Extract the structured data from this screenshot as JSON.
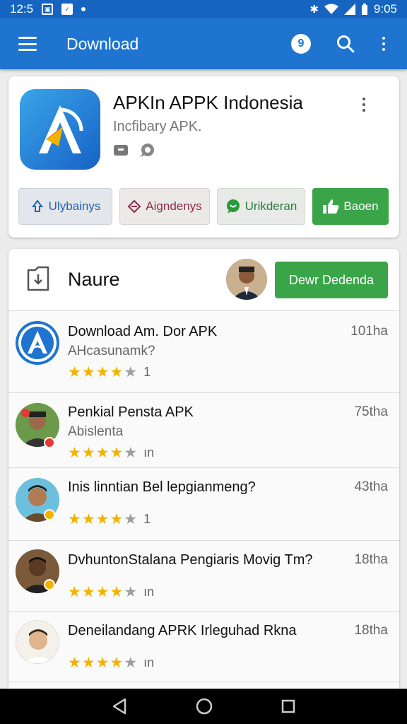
{
  "status_bar": {
    "time_left": "12:5",
    "time_right": "9:05"
  },
  "app_bar": {
    "title": "Download",
    "badge": "9"
  },
  "app_card": {
    "title": "APKIn APPK Indonesia",
    "subtitle": "Incfibary APK.",
    "buttons": [
      {
        "label": "Ulybainys",
        "icon": "share-icon"
      },
      {
        "label": "Aigndenys",
        "icon": "tag-icon"
      },
      {
        "label": "Urikderan",
        "icon": "chat-icon"
      },
      {
        "label": "Baoen",
        "icon": "thumbs-up-icon"
      }
    ]
  },
  "list_header": {
    "title": "Naure",
    "button_label": "Dewr Dedenda"
  },
  "rows": [
    {
      "title": "Download Am. Dor APK",
      "subtitle": "AHcasunamk?",
      "time": "101ha",
      "rating": 4,
      "count": "1"
    },
    {
      "title": "Penkial Pensta APK",
      "subtitle": "Abislenta",
      "time": "75tha",
      "rating": 4,
      "count": "ın"
    },
    {
      "title": "Inis linntian Bel lepgianmeng?",
      "subtitle": "",
      "time": "43tha",
      "rating": 4,
      "count": "1"
    },
    {
      "title": "DvhuntonStalana Pengiaris Movig Tm?",
      "subtitle": "",
      "time": "18tha",
      "rating": 4,
      "count": "ın"
    },
    {
      "title": "Deneilandang APRK Irleguhad Rkna",
      "subtitle": "",
      "time": "18tha",
      "rating": 4,
      "count": "ın"
    }
  ],
  "colors": {
    "primary": "#1e74cf",
    "green": "#3aa448",
    "star": "#f2b300"
  }
}
